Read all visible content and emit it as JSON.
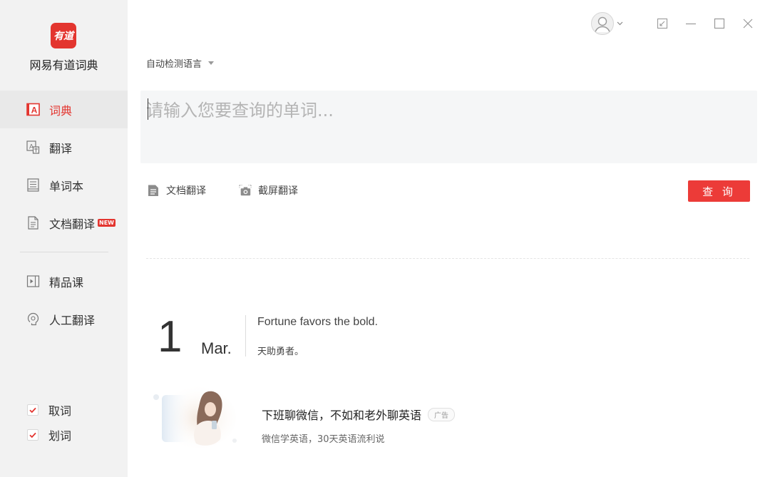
{
  "app": {
    "logo_text": "有道",
    "name": "网易有道词典"
  },
  "sidebar": {
    "items": [
      {
        "label": "词典",
        "icon": "dictionary-icon",
        "active": true
      },
      {
        "label": "翻译",
        "icon": "translate-icon",
        "active": false
      },
      {
        "label": "单词本",
        "icon": "wordbook-icon",
        "active": false
      },
      {
        "label": "文档翻译",
        "icon": "document-icon",
        "active": false,
        "badge": "NEW"
      },
      {
        "label": "精品课",
        "icon": "video-course-icon",
        "active": false
      },
      {
        "label": "人工翻译",
        "icon": "human-translation-icon",
        "active": false
      }
    ],
    "toggles": [
      {
        "label": "取词",
        "checked": true
      },
      {
        "label": "划词",
        "checked": true
      }
    ]
  },
  "search": {
    "language": "自动检测语言",
    "placeholder": "请输入您要查询的单词..."
  },
  "tools": {
    "doc_translate": "文档翻译",
    "screenshot_translate": "截屏翻译",
    "query_button": "查 询"
  },
  "daily": {
    "day": "1",
    "month": "Mar.",
    "sentence_en": "Fortune favors the bold.",
    "sentence_zh": "天助勇者。"
  },
  "ad": {
    "title": "下班聊微信，不如和老外聊英语",
    "tag": "广告",
    "subtitle": "微信学英语，30天英语流利说"
  },
  "colors": {
    "brand_red": "#e3352f",
    "button_red": "#ec3b38",
    "sidebar_bg": "#f2f2f2",
    "search_bg": "#f5f6f7"
  }
}
